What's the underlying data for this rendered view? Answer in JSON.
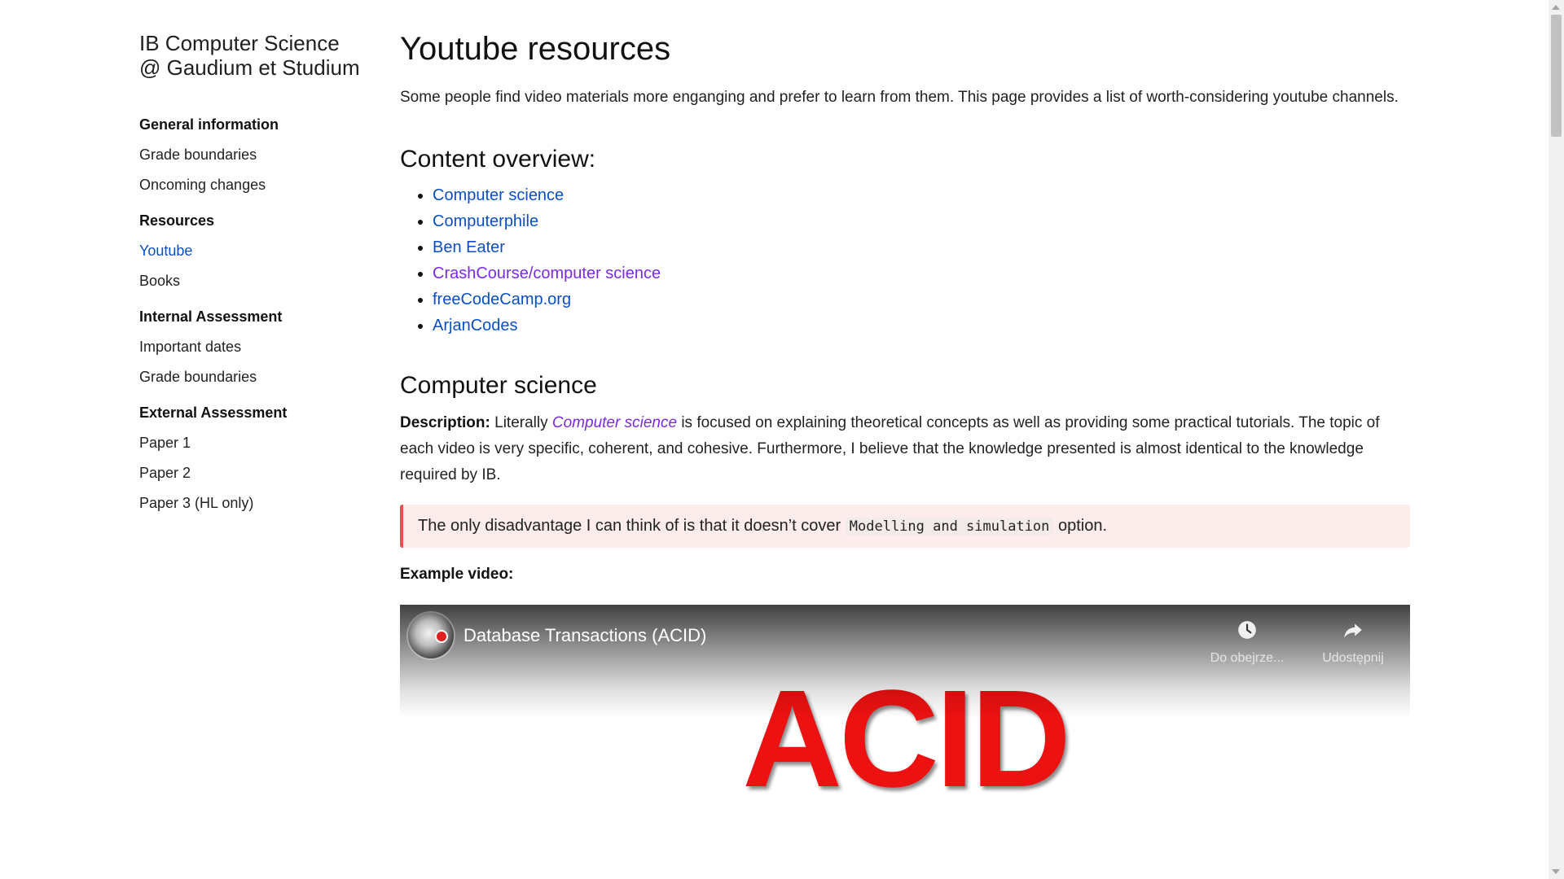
{
  "sidebar": {
    "title_line1": "IB Computer Science",
    "title_line2": "@ Gaudium et Studium",
    "sections": [
      {
        "heading": "General information",
        "items": [
          "Grade boundaries",
          "Oncoming changes"
        ]
      },
      {
        "heading": "Resources",
        "items": [
          "Youtube",
          "Books"
        ]
      },
      {
        "heading": "Internal Assessment",
        "items": [
          "Important dates",
          "Grade boundaries"
        ]
      },
      {
        "heading": "External Assessment",
        "items": [
          "Paper 1",
          "Paper 2",
          "Paper 3 (HL only)"
        ]
      }
    ]
  },
  "main": {
    "title": "Youtube resources",
    "intro": "Some people find video materials more enganging and prefer to learn from them. This page provides a list of worth-considering youtube channels.",
    "overview_heading": "Content overview:",
    "toc": [
      "Computer science",
      "Computerphile",
      "Ben Eater",
      "CrashCourse/computer science",
      "freeCodeCamp.org",
      "ArjanCodes"
    ],
    "cs_heading": "Computer science",
    "desc_label": "Description:",
    "desc_pre": "Literally",
    "desc_em": "Computer science",
    "desc_post": "is focused on explaining theoretical concepts as well as providing some practical tutorials. The topic of each video is very specific, coherent, and cohesive. Furthermore, I believe that the knowledge presented is almost identical to the knowledge required by IB.",
    "callout_pre": "The only disadvantage I can think of is that it doesn’t cover",
    "callout_code": "Modelling and simulation",
    "callout_post": "option.",
    "example_label": "Example video:"
  },
  "video": {
    "title": "Database Transactions (ACID)",
    "watch_later_label": "Do obejrze...",
    "share_label": "Udostępnij",
    "thumbnail_text": "ACID"
  },
  "colors": {
    "link": "#0b4fc3",
    "visited_link": "#7a2be2",
    "callout_bg": "#fdecec",
    "callout_border": "#e05252",
    "thumbnail_text": "#ee1111"
  }
}
